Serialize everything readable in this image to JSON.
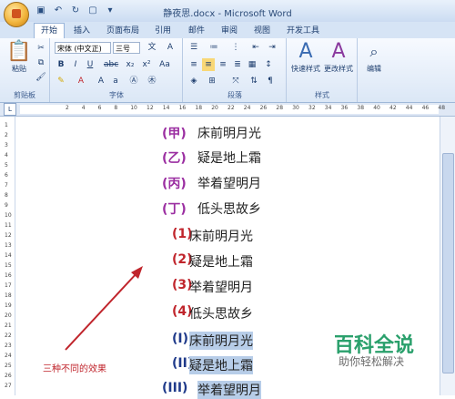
{
  "window": {
    "title": "静夜思.docx - Microsoft Word"
  },
  "tabs": [
    "开始",
    "插入",
    "页面布局",
    "引用",
    "邮件",
    "审阅",
    "视图",
    "开发工具"
  ],
  "ribbon": {
    "clipboard": {
      "paste_label": "粘贴",
      "group_label": "剪贴板"
    },
    "font": {
      "font_name": "宋体 (中文正)",
      "font_size": "三号",
      "group_label": "字体"
    },
    "paragraph": {
      "group_label": "段落"
    },
    "styles": {
      "quick_styles_label": "快速样式",
      "change_styles_label": "更改样式",
      "group_label": "样式"
    },
    "editing": {
      "label": "编辑"
    }
  },
  "ruler_numbers": [
    "2",
    "4",
    "6",
    "8",
    "10",
    "12",
    "14",
    "16",
    "18",
    "20",
    "22",
    "24",
    "26",
    "28",
    "30",
    "32",
    "34",
    "36",
    "38",
    "40",
    "42",
    "44",
    "46",
    "48"
  ],
  "vruler_numbers": [
    "1",
    "2",
    "3",
    "4",
    "5",
    "6",
    "7",
    "8",
    "9",
    "10",
    "11",
    "12",
    "13",
    "14",
    "15",
    "16",
    "17",
    "18",
    "19",
    "20",
    "21",
    "22",
    "23",
    "24",
    "25",
    "26",
    "27"
  ],
  "document": {
    "lines": [
      {
        "marker": "(甲)",
        "text": "床前明月光",
        "marker_color": "#9b2ea1",
        "highlight": false
      },
      {
        "marker": "(乙)",
        "text": "疑是地上霜",
        "marker_color": "#9b2ea1",
        "highlight": false
      },
      {
        "marker": "(丙)",
        "text": "举着望明月",
        "marker_color": "#9b2ea1",
        "highlight": false
      },
      {
        "marker": "(丁)",
        "text": "低头思故乡",
        "marker_color": "#9b2ea1",
        "highlight": false
      },
      {
        "marker": "(1)",
        "text": "床前明月光",
        "marker_color": "#c0252c",
        "highlight": false
      },
      {
        "marker": "(2)",
        "text": "疑是地上霜",
        "marker_color": "#c0252c",
        "highlight": false
      },
      {
        "marker": "(3)",
        "text": "举着望明月",
        "marker_color": "#c0252c",
        "highlight": false
      },
      {
        "marker": "(4)",
        "text": "低头思故乡",
        "marker_color": "#c0252c",
        "highlight": false
      },
      {
        "marker": "(I)",
        "text": "床前明月光",
        "marker_color": "#1f3a8a",
        "highlight": true
      },
      {
        "marker": "(II)",
        "text": "疑是地上霜",
        "marker_color": "#1f3a8a",
        "highlight": true
      },
      {
        "marker": "(III)",
        "text": "举着望明月",
        "marker_color": "#1f3a8a",
        "highlight": true
      }
    ],
    "annotation": "三种不同的效果"
  },
  "watermark": {
    "brand": "百科全说",
    "slogan": "助你轻松解决"
  }
}
